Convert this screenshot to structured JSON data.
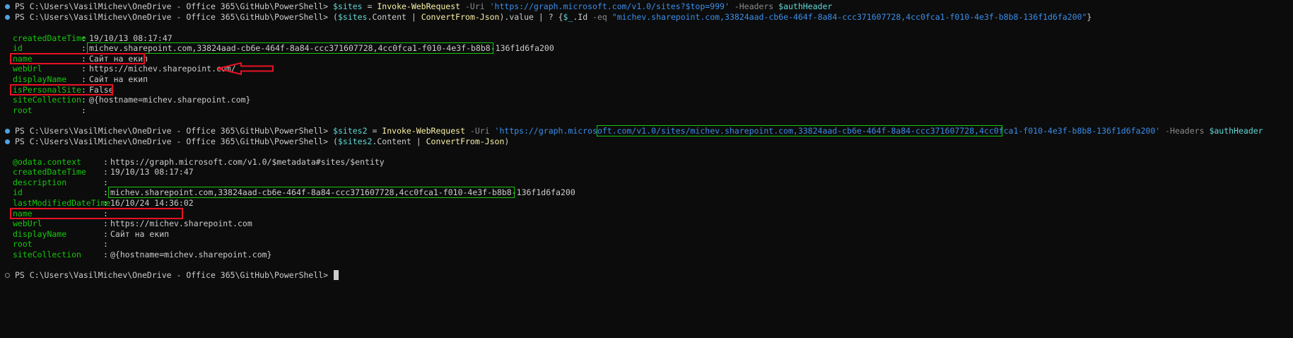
{
  "terminal": {
    "prompt": "PS C:\\Users\\VasilMichev\\OneDrive - Office 365\\GitHub\\PowerShell>",
    "cmd1": {
      "var": "$sites",
      "eq": " = ",
      "cmdlet": "Invoke-WebRequest",
      "p_uri": " -Uri ",
      "uri": "'https://graph.microsoft.com/v1.0/sites?$top=999'",
      "p_headers": " -Headers ",
      "hdr": "$authHeader"
    },
    "cmd2": {
      "open": "(",
      "var": "$sites",
      "content": ".Content | ",
      "cmdlet": "ConvertFrom-Json",
      "rest": ").value | ? {",
      "itvar": "$_",
      "idprop": ".Id ",
      "op": "-eq",
      "sp": " ",
      "val": "\"michev.sharepoint.com,33824aad-cb6e-464f-8a84-ccc371607728,4cc0fca1-f010-4e3f-b8b8-136f1d6fa200\"",
      "close": "}"
    },
    "out1": [
      {
        "k": "createdDateTime",
        "v": "19/10/13 08:17:47"
      },
      {
        "k": "id",
        "v": "michev.sharepoint.com,33824aad-cb6e-464f-8a84-ccc371607728,4cc0fca1-f010-4e3f-b8b8-136f1d6fa200"
      },
      {
        "k": "name",
        "v": "Сайт на екип"
      },
      {
        "k": "webUrl",
        "v": "https://michev.sharepoint.com/"
      },
      {
        "k": "displayName",
        "v": "Сайт на екип"
      },
      {
        "k": "isPersonalSite",
        "v": "False"
      },
      {
        "k": "siteCollection",
        "v": "@{hostname=michev.sharepoint.com}"
      },
      {
        "k": "root",
        "v": ""
      }
    ],
    "cmd3": {
      "var": "$sites2",
      "eq": " = ",
      "cmdlet": "Invoke-WebRequest",
      "p_uri": " -Uri ",
      "uri_a": "'https://graph.microsoft.com/v1.0/sites/",
      "uri_b": "michev.sharepoint.com,33824aad-cb6e-464f-8a84-ccc371607728,4cc0fca1-f010-4e3f-b8b8-136f1d6fa200",
      "uri_c": "'",
      "p_headers": " -Headers ",
      "hdr": "$authHeader"
    },
    "cmd4": {
      "open": "(",
      "var": "$sites2",
      "content": ".Content | ",
      "cmdlet": "ConvertFrom-Json",
      "close": ")"
    },
    "out2": [
      {
        "k": "@odata.context",
        "v": "https://graph.microsoft.com/v1.0/$metadata#sites/$entity"
      },
      {
        "k": "createdDateTime",
        "v": "19/10/13 08:17:47"
      },
      {
        "k": "description",
        "v": ""
      },
      {
        "k": "id",
        "v": "michev.sharepoint.com,33824aad-cb6e-464f-8a84-ccc371607728,4cc0fca1-f010-4e3f-b8b8-136f1d6fa200"
      },
      {
        "k": "lastModifiedDateTime",
        "v": "16/10/24 14:36:02"
      },
      {
        "k": "name",
        "v": ""
      },
      {
        "k": "webUrl",
        "v": "https://michev.sharepoint.com"
      },
      {
        "k": "displayName",
        "v": "Сайт на екип"
      },
      {
        "k": "root",
        "v": ""
      },
      {
        "k": "siteCollection",
        "v": "@{hostname=michev.sharepoint.com}"
      }
    ],
    "separator": ":",
    "colors": {
      "background": "#0c0c0c",
      "highlight_red": "#e81123",
      "highlight_green": "#16c60c"
    }
  }
}
